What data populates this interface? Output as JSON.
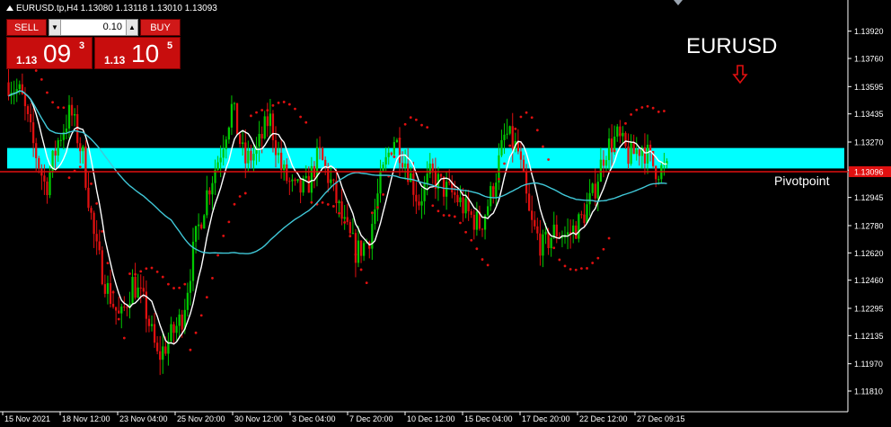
{
  "window": {
    "title": "EURUSD.tp,H4  1.13080 1.13118 1.13010 1.13093"
  },
  "trade_panel": {
    "sell_label": "SELL",
    "buy_label": "BUY",
    "lot_value": "0.10",
    "lot_down_icon": "triangle-down-icon",
    "lot_up_icon": "triangle-up-icon",
    "sell_price_prefix": "1.13",
    "sell_price_main": "09",
    "sell_price_sup": "3",
    "buy_price_prefix": "1.13",
    "buy_price_main": "10",
    "buy_price_sup": "5"
  },
  "chart_data": {
    "type": "candlestick",
    "symbol": "EURUSD",
    "annotation_title": "EURUSD",
    "annotation_arrow": "down-arrow-icon",
    "pivot_label": "Pivotpoint",
    "pivot_level": 1.13096,
    "current_price_label": "1.13096",
    "resistance_zone": [
      1.13115,
      1.13235
    ],
    "ylim": [
      1.1181,
      1.1405
    ],
    "y_ticks": [
      "1.13920",
      "1.13760",
      "1.13595",
      "1.13435",
      "1.13270",
      "1.13105",
      "1.12945",
      "1.12780",
      "1.12620",
      "1.12460",
      "1.12295",
      "1.12135",
      "1.11970",
      "1.11810"
    ],
    "x_ticks": [
      "15 Nov 2021",
      "18 Nov 12:00",
      "23 Nov 04:00",
      "25 Nov 20:00",
      "30 Nov 12:00",
      "3 Dec 04:00",
      "7 Dec 20:00",
      "10 Dec 12:00",
      "15 Dec 04:00",
      "17 Dec 20:00",
      "22 Dec 12:00",
      "27 Dec 09:15"
    ],
    "series_close": [
      1.1362,
      1.1355,
      1.1325,
      1.13,
      1.1328,
      1.1345,
      1.1318,
      1.1265,
      1.124,
      1.1222,
      1.1245,
      1.123,
      1.12,
      1.1212,
      1.1225,
      1.1268,
      1.1298,
      1.132,
      1.1348,
      1.1315,
      1.1322,
      1.1342,
      1.131,
      1.1298,
      1.13,
      1.132,
      1.1302,
      1.1278,
      1.1262,
      1.127,
      1.1305,
      1.133,
      1.1315,
      1.1292,
      1.1308,
      1.13,
      1.1295,
      1.1285,
      1.1278,
      1.13,
      1.1332,
      1.1322,
      1.128,
      1.1265,
      1.1275,
      1.1272,
      1.128,
      1.1295,
      1.1322,
      1.133,
      1.1318,
      1.1325,
      1.1312,
      1.131
    ],
    "colors": {
      "bull": "#00c800",
      "bear": "#e01010",
      "ma_fast": "#ffffff",
      "ma_slow": "#40c8d8",
      "psar": "#e01010",
      "zone": "#00ffff",
      "pivot": "#e01010",
      "grid_text": "#ffffff",
      "price_tag_bg": "#e01010"
    }
  }
}
